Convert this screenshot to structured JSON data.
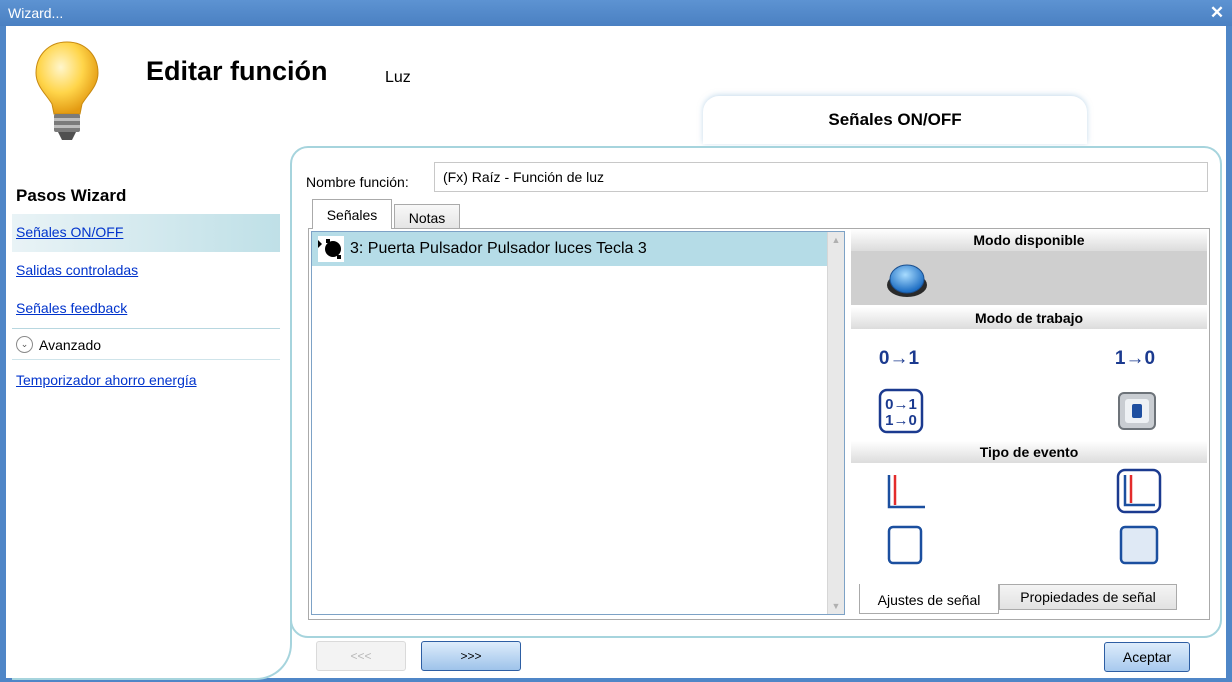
{
  "window": {
    "title": "Wizard...",
    "close_glyph": "✕"
  },
  "header": {
    "title": "Editar función",
    "subtitle": "Luz",
    "icon": "light-bulb-icon"
  },
  "top_tab": {
    "label": "Señales ON/OFF"
  },
  "sidebar": {
    "title": "Pasos Wizard",
    "items": [
      {
        "label": "Señales ON/OFF",
        "active": true
      },
      {
        "label": "Salidas controladas",
        "active": false
      },
      {
        "label": "Señales feedback",
        "active": false
      }
    ],
    "advanced": {
      "label": "Avanzado",
      "glyph": "⌄"
    },
    "advanced_items": [
      {
        "label": "Temporizador ahorro energía"
      }
    ]
  },
  "function_name": {
    "label": "Nombre función:",
    "value": "(Fx) Raíz - Función de luz"
  },
  "tabs": [
    {
      "label": "Señales",
      "active": true
    },
    {
      "label": "Notas",
      "active": false
    }
  ],
  "signals": [
    {
      "label": "3: Puerta Pulsador Pulsador luces Tecla 3",
      "icon": "pushbutton-signal-icon"
    }
  ],
  "scroll": {
    "up": "▲",
    "down": "▼"
  },
  "properties": {
    "available_mode": {
      "title": "Modo disponible",
      "icons": [
        "pushbutton-icon"
      ]
    },
    "work_mode": {
      "title": "Modo de trabajo",
      "icons": [
        "transition-0-to-1-icon",
        "transition-1-to-0-icon",
        "transition-both-icon",
        "switch-mode-icon"
      ],
      "labels": {
        "t01": "0→1",
        "t10": "1→0"
      }
    },
    "event_type": {
      "title": "Tipo de evento",
      "icons": [
        "rising-edge-icon",
        "rising-edge-selected-icon"
      ]
    }
  },
  "bottom_tabs": [
    {
      "label": "Ajustes de señal",
      "active": true
    },
    {
      "label": "Propiedades de señal",
      "active": false
    }
  ],
  "nav": {
    "prev": "<<<",
    "next": ">>>",
    "accept": "Aceptar"
  },
  "colors": {
    "titlebar": "#4f86c7",
    "selection": "#b5dce7",
    "panel_border": "#a6d4dd",
    "link": "#0033cc"
  }
}
